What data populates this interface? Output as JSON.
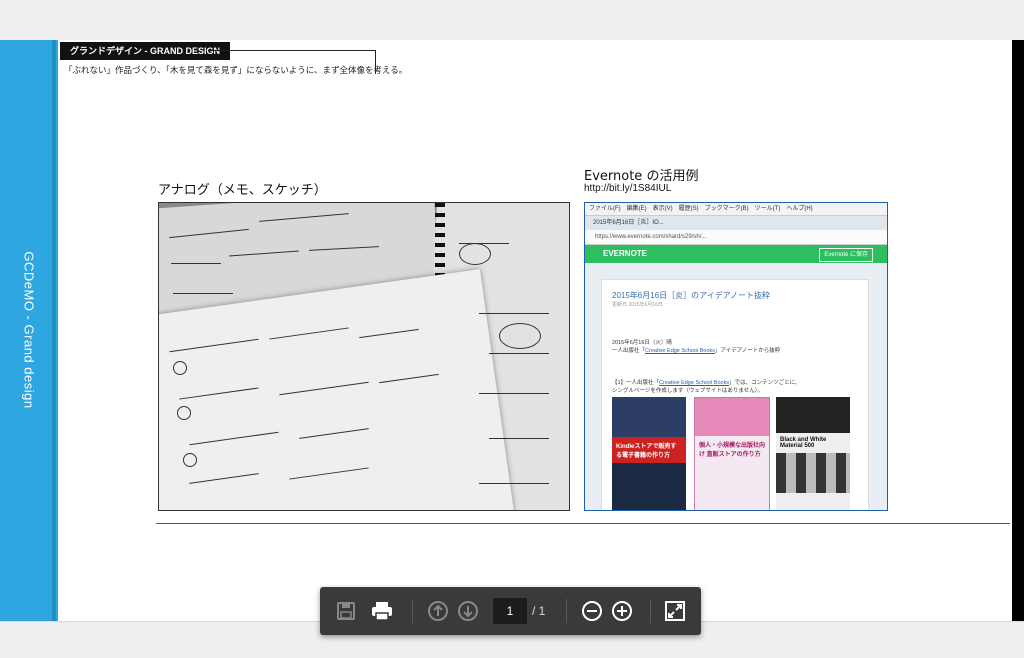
{
  "page": {
    "header_tag": "グランドデザイン - GRAND DESIGN",
    "header_sub": "「ぶれない」作品づくり、「木を見て森を見ず」にならないように、まず全体像を考える。",
    "side_label": "GCDeMO - Grand design",
    "caption_left": "アナログ（メモ、スケッチ）",
    "caption_right": "Evernote の活用例",
    "caption_url": "http://bit.ly/1S84IUL"
  },
  "screenshot": {
    "menubar": "ファイル(F)　編集(E)　表示(V)　履歴(S)　ブックマーク(B)　ツール(T)　ヘルプ(H)",
    "tab": "2015年6月16日［炎］IO...",
    "url": "https://www.evernote.com/shard/s29/sh/...",
    "brand": "EVERNOTE",
    "save_button": "Evernote に保存",
    "note_title": "2015年6月16日［炎］のアイデアノート抜粋",
    "note_meta": "更新日 2015年6月16日",
    "line1": "2015年6月16日（火）晴",
    "line2_prefix": "一人出版社「",
    "line2_link": "Creative Edge School Books",
    "line2_suffix": "」アイデアノートから抜粋",
    "line3_prefix": "【1】一人出版社「",
    "line3_link": "Creative Edge School Books",
    "line3_suffix": "」では、コンテンツごとに、",
    "line4": "シングルページを作成します（ウェブサイトはありません）。",
    "book1_title": "Kindleストアで販売する電子書籍の作り方",
    "book2_title": "個人・小規模な出版社向け 直販ストアの作り方",
    "book3_title": "Black and White Material 500"
  },
  "toolbar": {
    "page_current": "1",
    "page_total": "/ 1"
  },
  "colors": {
    "strip": "#2ea7e0",
    "evernote_green": "#2dbe60",
    "toolbar_bg": "#3a3a3a"
  },
  "icons": [
    "save-icon",
    "print-icon",
    "arrow-up-icon",
    "arrow-down-icon",
    "zoom-out-icon",
    "zoom-in-icon",
    "fit-page-icon"
  ]
}
